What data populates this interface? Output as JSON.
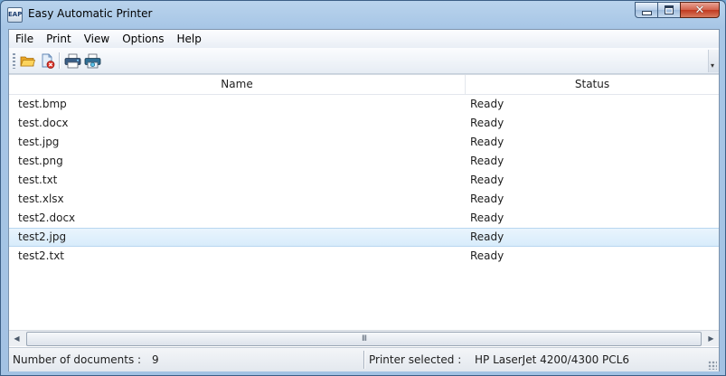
{
  "window": {
    "title": "Easy Automatic Printer",
    "icon_label": "EAP",
    "close_glyph": "✕"
  },
  "menu": [
    "File",
    "Print",
    "View",
    "Options",
    "Help"
  ],
  "toolbar": {
    "icons": [
      "open-folder-icon",
      "remove-document-icon",
      "printer-icon",
      "printer-settings-icon"
    ]
  },
  "list": {
    "columns": [
      "Name",
      "Status"
    ],
    "rows": [
      {
        "name": "test.bmp",
        "status": "Ready"
      },
      {
        "name": "test.docx",
        "status": "Ready"
      },
      {
        "name": "test.jpg",
        "status": "Ready"
      },
      {
        "name": "test.png",
        "status": "Ready"
      },
      {
        "name": "test.txt",
        "status": "Ready"
      },
      {
        "name": "test.xlsx",
        "status": "Ready"
      },
      {
        "name": "test2.docx",
        "status": "Ready"
      },
      {
        "name": "test2.jpg",
        "status": "Ready",
        "selected": true
      },
      {
        "name": "test2.txt",
        "status": "Ready"
      }
    ]
  },
  "scrollbar": {
    "thumb_grip": "III"
  },
  "statusbar": {
    "doc_count_label": "Number of documents :",
    "doc_count": "9",
    "printer_label": "Printer selected :",
    "printer_name": "HP LaserJet 4200/4300 PCL6"
  },
  "colors": {
    "selection": "#d8ecfb",
    "titlebar": "#a7c6e6",
    "close": "#c0391f"
  }
}
